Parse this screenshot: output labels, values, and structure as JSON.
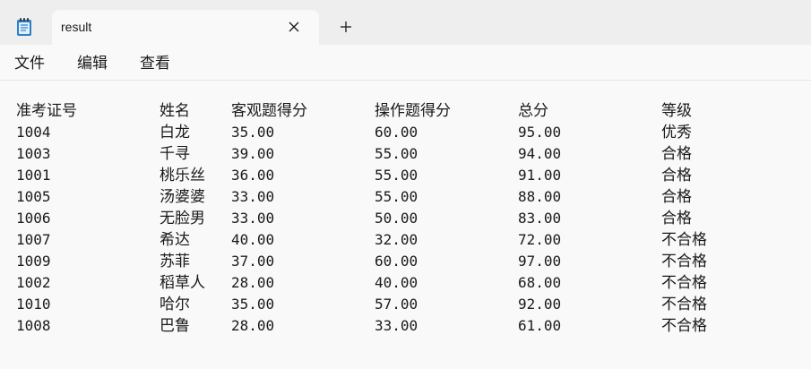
{
  "window": {
    "tab_title": "result",
    "app_icon": "notepad-icon",
    "close_icon": "close-icon",
    "new_tab_icon": "plus-icon"
  },
  "menu": {
    "file": "文件",
    "edit": "编辑",
    "view": "查看"
  },
  "table": {
    "headers": [
      "准考证号",
      "姓名",
      "客观题得分",
      "操作题得分",
      "总分",
      "等级"
    ],
    "rows": [
      [
        "1004",
        "白龙",
        "35.00",
        "60.00",
        "95.00",
        "优秀"
      ],
      [
        "1003",
        "千寻",
        "39.00",
        "55.00",
        "94.00",
        "合格"
      ],
      [
        "1001",
        "桃乐丝",
        "36.00",
        "55.00",
        "91.00",
        "合格"
      ],
      [
        "1005",
        "汤婆婆",
        "33.00",
        "55.00",
        "88.00",
        "合格"
      ],
      [
        "1006",
        "无脸男",
        "33.00",
        "50.00",
        "83.00",
        "合格"
      ],
      [
        "1007",
        "希达",
        "40.00",
        "32.00",
        "72.00",
        "不合格"
      ],
      [
        "1009",
        "苏菲",
        "37.00",
        "60.00",
        "97.00",
        "不合格"
      ],
      [
        "1002",
        "稻草人",
        "28.00",
        "40.00",
        "68.00",
        "不合格"
      ],
      [
        "1010",
        "哈尔",
        "35.00",
        "57.00",
        "92.00",
        "不合格"
      ],
      [
        "1008",
        "巴鲁",
        "28.00",
        "33.00",
        "61.00",
        "不合格"
      ]
    ]
  }
}
